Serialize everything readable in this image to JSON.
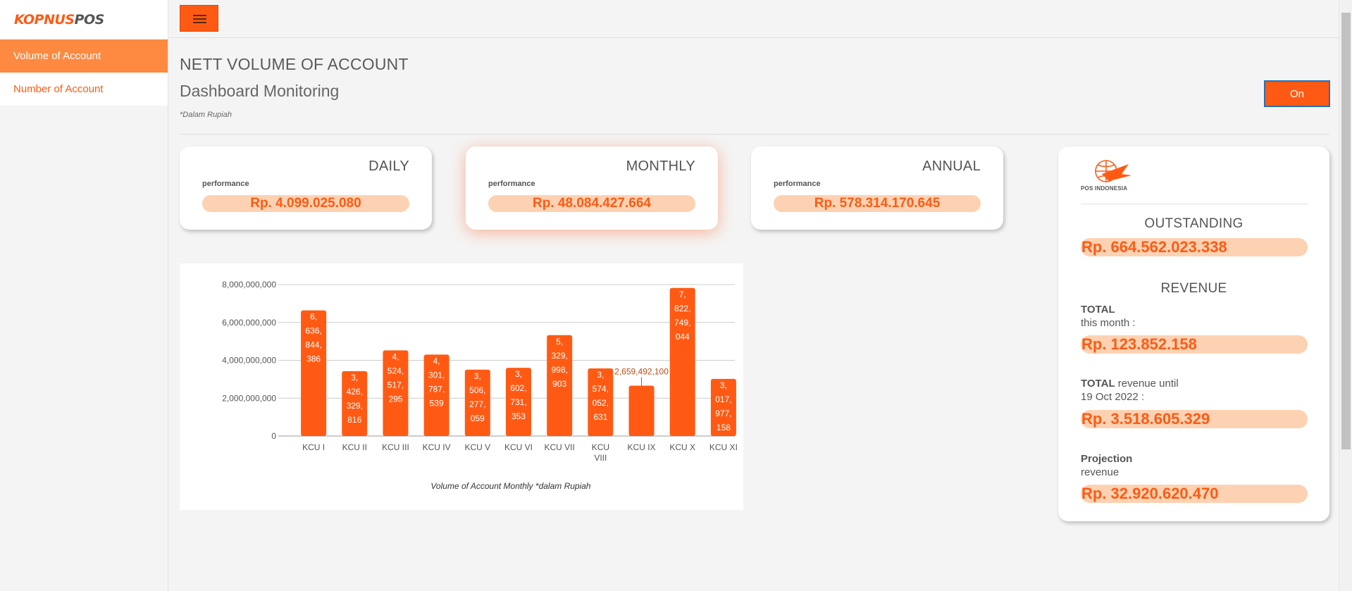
{
  "brand": {
    "part1": "KOPNUS",
    "part2": "POS"
  },
  "sidebar": {
    "items": [
      {
        "label": "Volume of Account",
        "active": true
      },
      {
        "label": "Number of Account",
        "active": false
      }
    ]
  },
  "header": {
    "title": "NETT VOLUME OF ACCOUNT",
    "subtitle": "Dashboard Monitoring",
    "note": "*Dalam Rupiah",
    "toggle_label": "On"
  },
  "cards": [
    {
      "title": "DAILY",
      "label": "performance",
      "value": "Rp. 4.099.025.080"
    },
    {
      "title": "MONTHLY",
      "label": "performance",
      "value": "Rp. 48.084.427.664"
    },
    {
      "title": "ANNUAL",
      "label": "performance",
      "value": "Rp. 578.314.170.645"
    }
  ],
  "right_panel": {
    "logo_text": "POS INDONESIA",
    "outstanding_title": "OUTSTANDING",
    "outstanding_value": "Rp. 664.562.023.338",
    "revenue_title": "REVENUE",
    "total_month_bold": "TOTAL",
    "total_month_rest": "this month :",
    "total_month_value": "Rp. 123.852.158",
    "total_until_bold": "TOTAL",
    "total_until_rest": "revenue until",
    "total_until_date": "19 Oct 2022 :",
    "total_until_value": "Rp. 3.518.605.329",
    "projection_bold": "Projection",
    "projection_rest": "revenue",
    "projection_value": "Rp. 32.920.620.470"
  },
  "colors": {
    "accent": "#ff5a14",
    "accent_light": "#fdd2b2",
    "sidebar_active": "#fd8a40"
  },
  "chart_data": {
    "type": "bar",
    "categories": [
      "KCU I",
      "KCU II",
      "KCU III",
      "KCU IV",
      "KCU V",
      "KCU VI",
      "KCU VII",
      "KCU VIII",
      "KCU IX",
      "KCU X",
      "KCU XI"
    ],
    "values": [
      6636844386,
      3426329816,
      4524517295,
      4301787539,
      3506277059,
      3602731353,
      5329998903,
      3574052631,
      2659492100,
      7822749044,
      3017977158
    ],
    "data_labels": [
      "6,636,844,386",
      "3,426,329,816",
      "4,524,517,295",
      "4,301,787,539",
      "3,506,277,059",
      "3,602,731,353",
      "5,329,998,903",
      "3,574,052,631",
      "2,659,492,100",
      "7,822,749,044",
      "3,017,977,158"
    ],
    "yticks": [
      "0",
      "2,000,000,000",
      "4,000,000,000",
      "6,000,000,000",
      "8,000,000,000"
    ],
    "ylim": [
      0,
      8000000000
    ],
    "caption": "Volume of Account Monthly *dalam Rupiah",
    "grid": true,
    "bar_color": "#ff5a14"
  }
}
